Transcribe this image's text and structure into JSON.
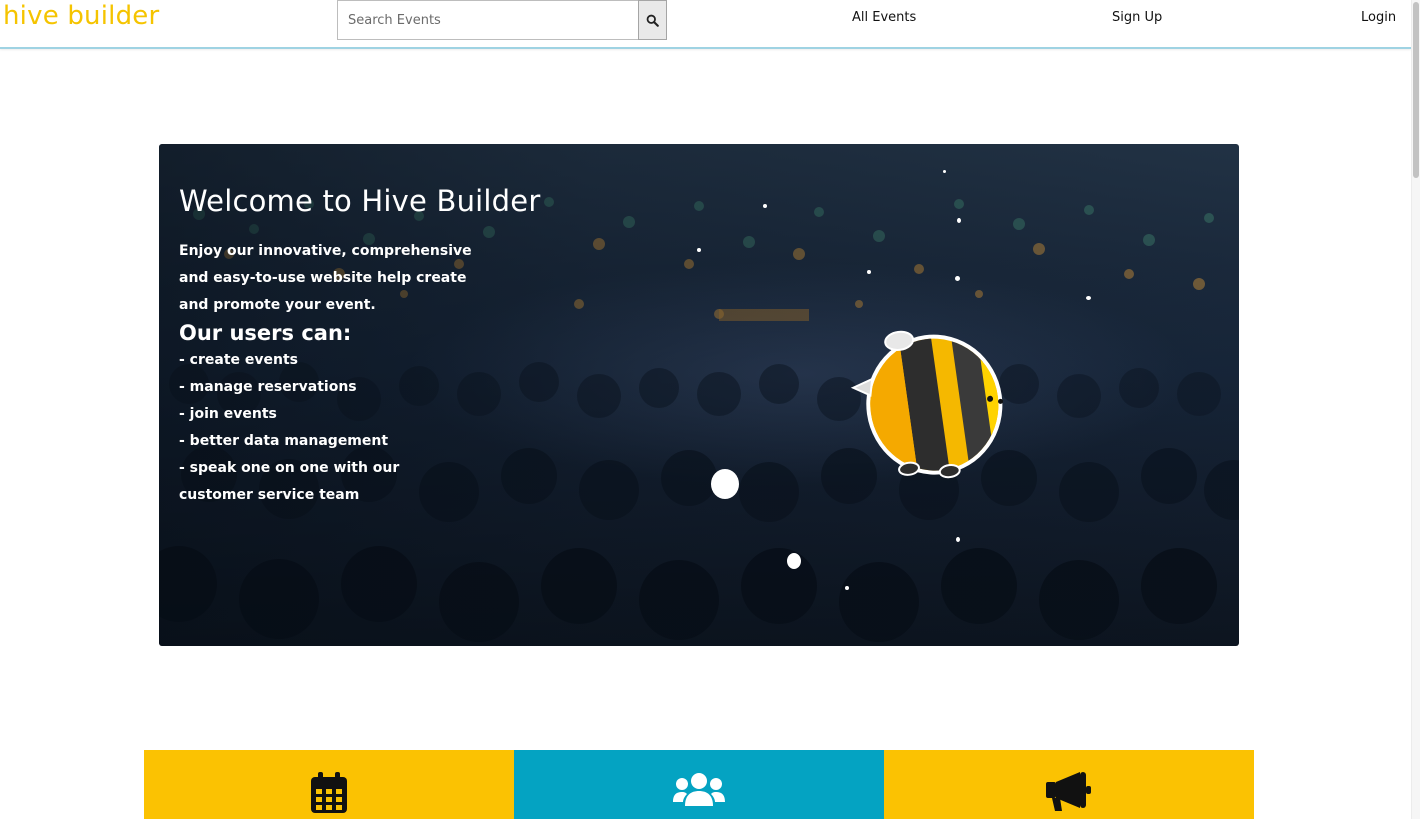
{
  "navbar": {
    "brand": "hive builder",
    "search": {
      "placeholder": "Search Events",
      "value": ""
    },
    "links": {
      "all_events": "All Events",
      "sign_up": "Sign Up",
      "login": "Login"
    }
  },
  "hero": {
    "title": "Welcome to Hive Builder",
    "intro": "Enjoy our innovative, comprehensive and easy-to-use website help create and promote your event.",
    "subtitle": "Our users can:",
    "list": [
      "- create events",
      "- manage reservations",
      "- join events",
      "- better data management",
      "- speak one on one with our customer service team"
    ]
  },
  "tiles": [
    {
      "icon": "calendar-icon",
      "color": "#fbc202"
    },
    {
      "icon": "users-icon",
      "color": "#04a3c2"
    },
    {
      "icon": "megaphone-icon",
      "color": "#fbc202"
    }
  ],
  "colors": {
    "brand": "#f5c400",
    "yellow": "#fbc202",
    "teal": "#04a3c2"
  }
}
